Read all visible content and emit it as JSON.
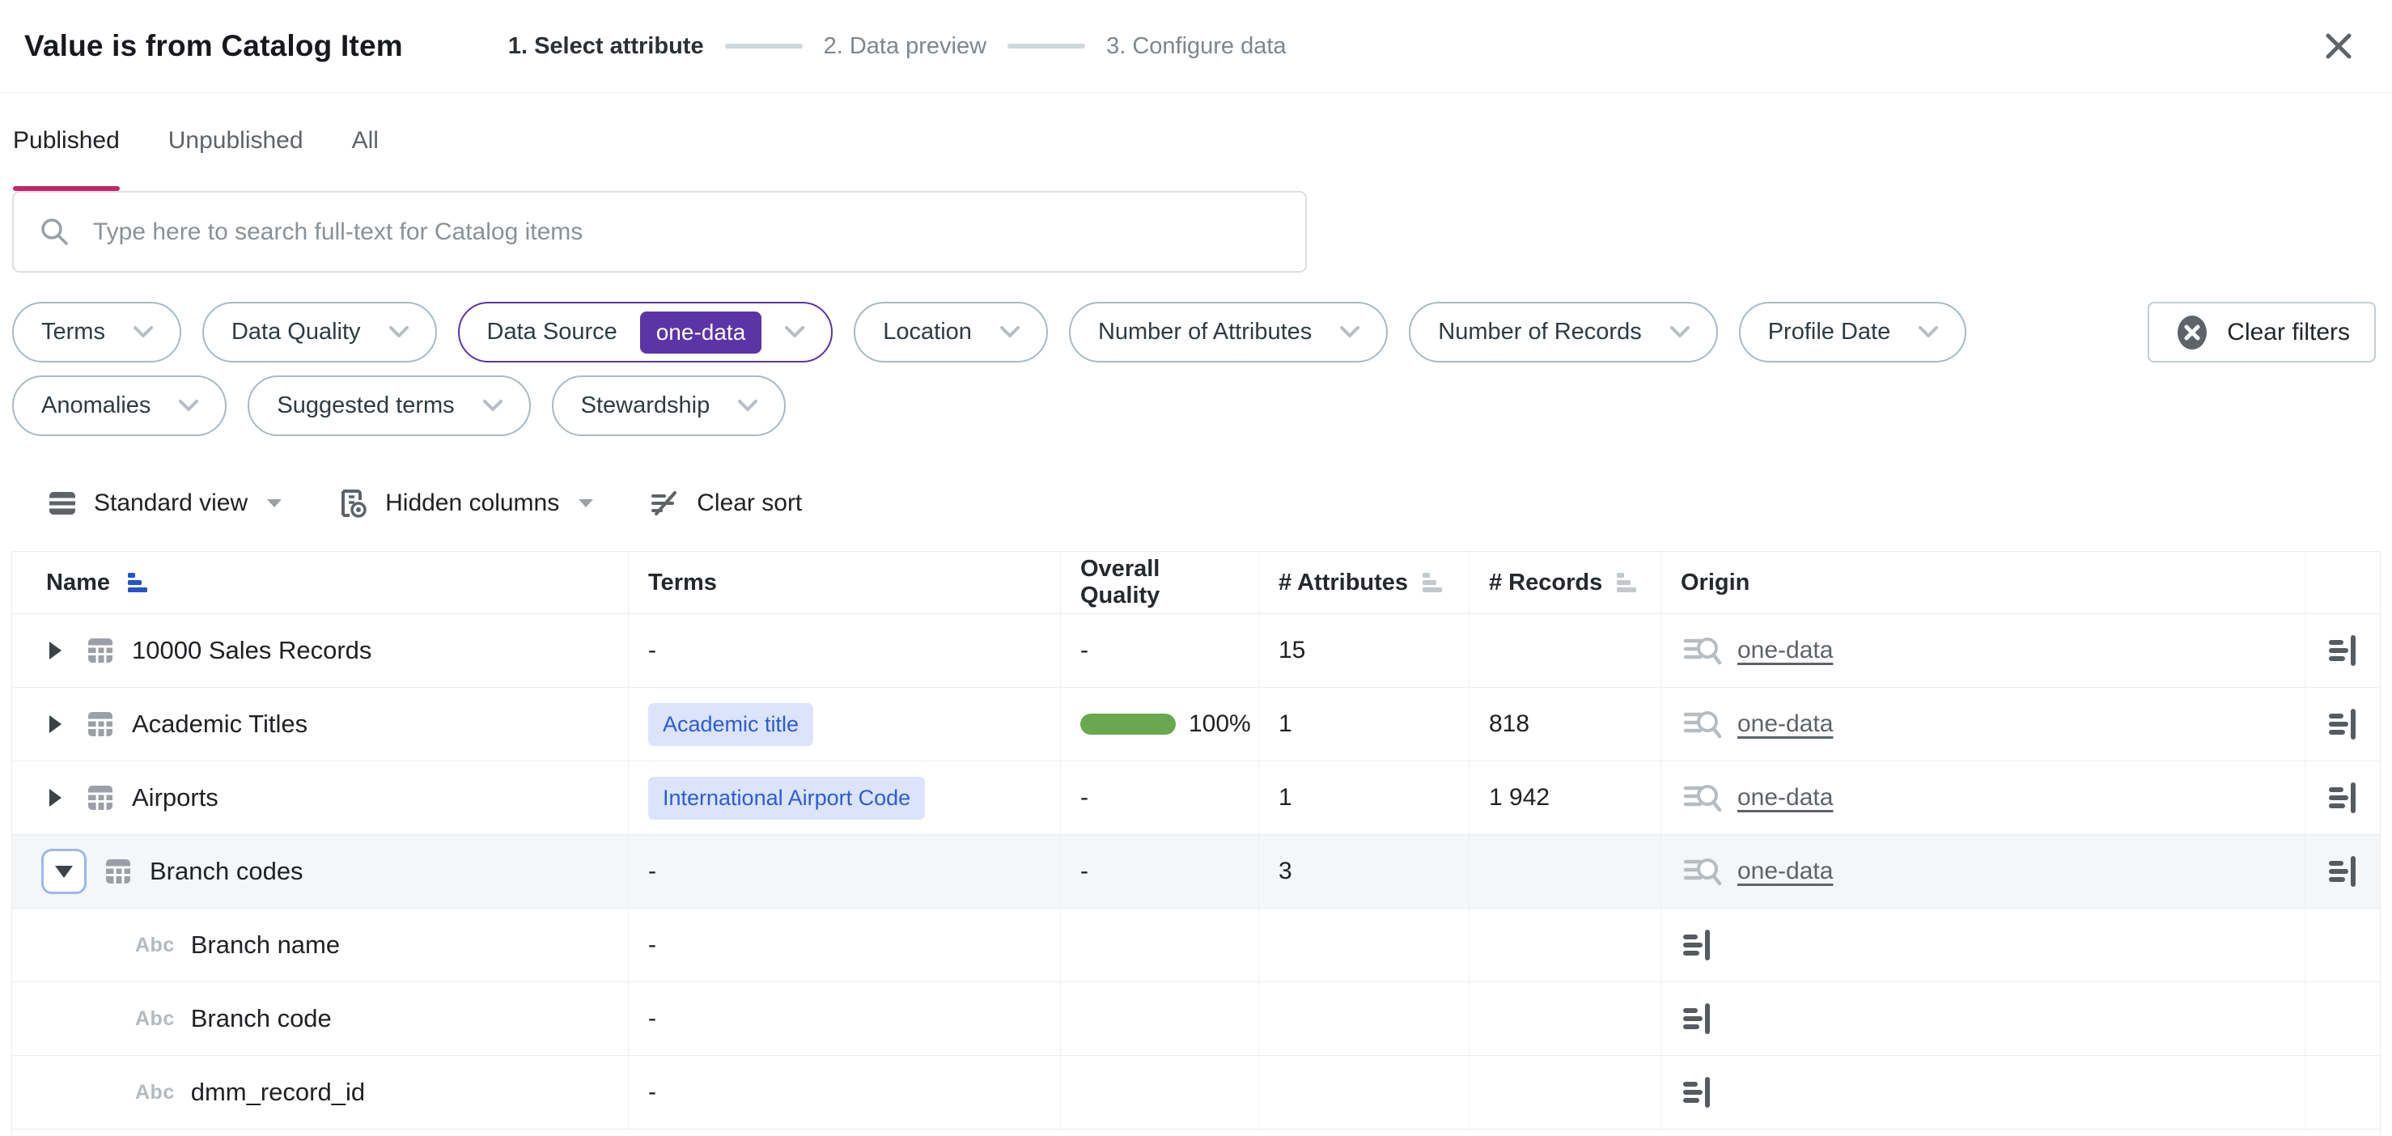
{
  "colors": {
    "accent_purple": "#5b34a6",
    "tab_underline": "#c2246c",
    "quality_green": "#6aa84f",
    "term_pill_bg": "#dbe4fa",
    "term_pill_text": "#2c5cd6",
    "sort_active_blue": "#2453cc"
  },
  "icons": {
    "close": "x-cross",
    "search": "magnifier",
    "chip_chevron": "chevron-down",
    "clear_filters": "circle-x",
    "standard_view": "rows-grid",
    "hidden_columns": "column-eye",
    "clear_sort": "sort-lines-slash",
    "sort": "sort-bars",
    "expand_collapsed": "triangle-right",
    "expand_open": "triangle-down",
    "catalog_item": "table-grid",
    "attribute_type": "Abc",
    "origin_source": "lineage-magnifier",
    "detail": "lines-pipe"
  },
  "modal": {
    "title": "Value is from Catalog Item",
    "steps": [
      {
        "label": "1. Select attribute",
        "active": true
      },
      {
        "label": "2. Data preview",
        "active": false
      },
      {
        "label": "3. Configure data",
        "active": false
      }
    ]
  },
  "tabs": [
    {
      "label": "Published",
      "active": true
    },
    {
      "label": "Unpublished",
      "active": false
    },
    {
      "label": "All",
      "active": false
    }
  ],
  "search": {
    "placeholder": "Type here to search full-text for Catalog items"
  },
  "filters": {
    "row1": [
      {
        "label": "Terms"
      },
      {
        "label": "Data Quality"
      },
      {
        "label": "Data Source",
        "value": "one-data",
        "active": true
      },
      {
        "label": "Location"
      },
      {
        "label": "Number of Attributes"
      },
      {
        "label": "Number of Records"
      },
      {
        "label": "Profile Date"
      }
    ],
    "row2": [
      {
        "label": "Anomalies"
      },
      {
        "label": "Suggested terms"
      },
      {
        "label": "Stewardship"
      }
    ],
    "clear_label": "Clear filters"
  },
  "toolbar": {
    "view_label": "Standard view",
    "hidden_columns_label": "Hidden columns",
    "clear_sort_label": "Clear sort"
  },
  "table": {
    "columns": [
      {
        "label": "Name",
        "sort": "active"
      },
      {
        "label": "Terms",
        "sort": null
      },
      {
        "label": "Overall Quality",
        "sort": null
      },
      {
        "label": "# Attributes",
        "sort": "inactive"
      },
      {
        "label": "# Records",
        "sort": "inactive"
      },
      {
        "label": "Origin",
        "sort": null
      },
      {
        "label": "",
        "sort": null
      }
    ],
    "rows": [
      {
        "kind": "catalog-item",
        "name": "10000 Sales Records",
        "expanded": false,
        "selected": false,
        "terms": "-",
        "quality": "-",
        "quality_pct": null,
        "attributes": "15",
        "records": "",
        "origin": "one-data"
      },
      {
        "kind": "catalog-item",
        "name": "Academic Titles",
        "expanded": false,
        "selected": false,
        "terms_pill": "Academic title",
        "quality_pct": "100%",
        "attributes": "1",
        "records": "818",
        "origin": "one-data"
      },
      {
        "kind": "catalog-item",
        "name": "Airports",
        "expanded": false,
        "selected": false,
        "terms_pill": "International Airport Code",
        "quality": "-",
        "attributes": "1",
        "records": "1 942",
        "origin": "one-data"
      },
      {
        "kind": "catalog-item",
        "name": "Branch codes",
        "expanded": true,
        "selected": true,
        "terms": "-",
        "quality": "-",
        "attributes": "3",
        "records": "",
        "origin": "one-data"
      },
      {
        "kind": "attribute",
        "name": "Branch name",
        "terms": "-"
      },
      {
        "kind": "attribute",
        "name": "Branch code",
        "terms": "-"
      },
      {
        "kind": "attribute",
        "name": "dmm_record_id",
        "terms": "-"
      }
    ]
  }
}
